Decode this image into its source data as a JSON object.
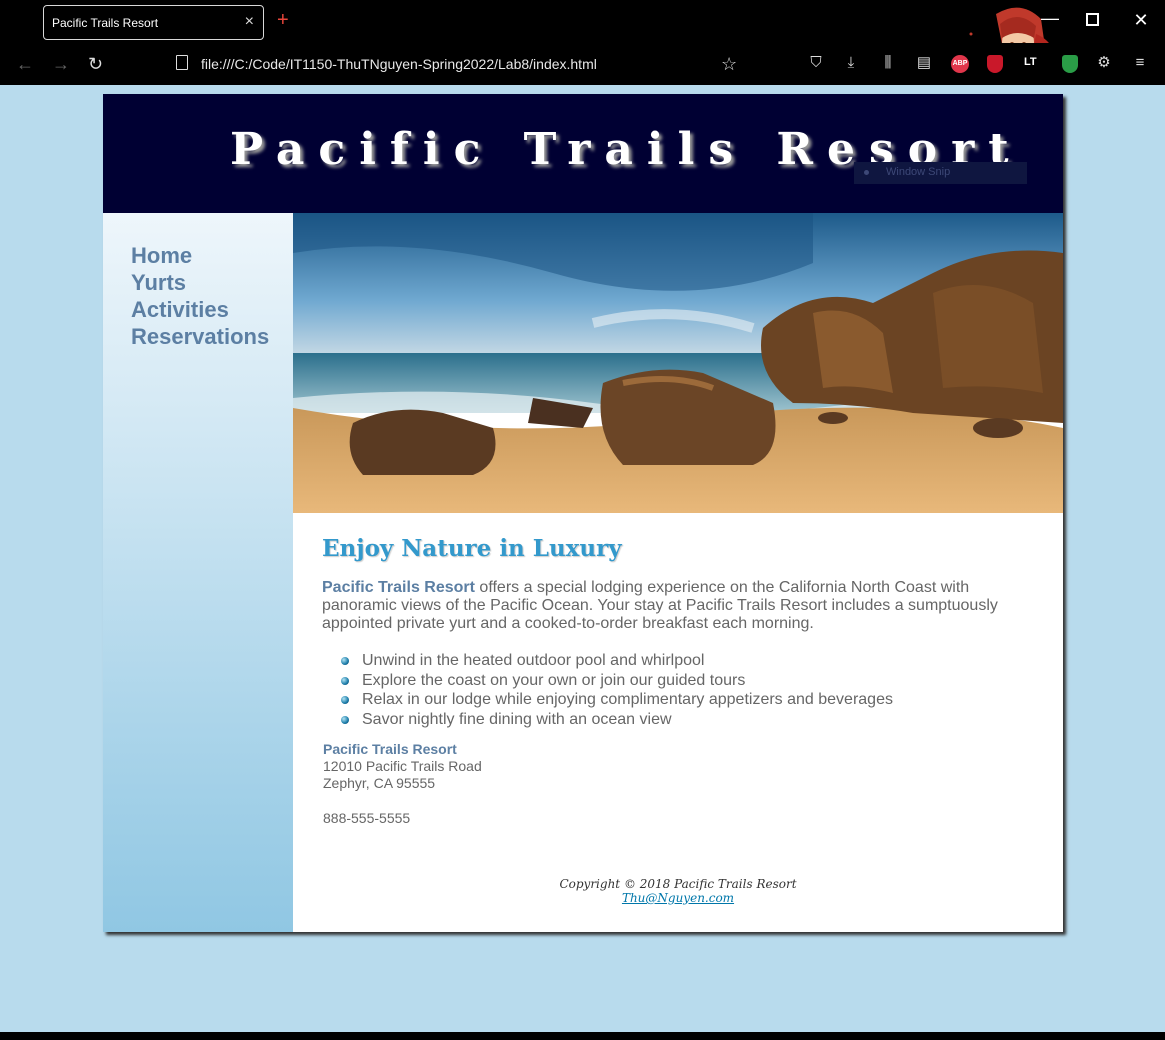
{
  "browser": {
    "tab_title": "Pacific Trails Resort",
    "tab_close": "×",
    "new_tab": "+",
    "url": "file:///C:/Code/IT1150-ThuTNguyen-Spring2022/Lab8/index.html",
    "extensions": {
      "abp_label": "ABP",
      "lt_label": "LT"
    }
  },
  "page": {
    "site_title": "Pacific Trails Resort",
    "snip_overlay": "Window Snip",
    "nav": [
      "Home",
      "Yurts",
      "Activities",
      "Reservations"
    ],
    "heading": "Enjoy Nature in Luxury",
    "intro_strong": "Pacific Trails Resort",
    "intro_text": " offers a special lodging experience on the California North Coast with panoramic views of the Pacific Ocean. Your stay at Pacific Trails Resort includes a sumptuously appointed private yurt and a cooked-to-order breakfast each morning.",
    "features": [
      "Unwind in the heated outdoor pool and whirlpool",
      "Explore the coast on your own or join our guided tours",
      "Relax in our lodge while enjoying complimentary appetizers and beverages",
      "Savor nightly fine dining with an ocean view"
    ],
    "contact": {
      "name": "Pacific Trails Resort",
      "street": "12010 Pacific Trails Road",
      "city": "Zephyr, CA 95555",
      "phone": "888-555-5555"
    },
    "footer": {
      "copyright": "Copyright © 2018 Pacific Trails Resort",
      "email": "Thu@Nguyen.com"
    }
  },
  "colors": {
    "header_bg": "#000033",
    "page_bg": "#b8dbed",
    "nav_text": "#5c7fa3",
    "heading": "#3399cc"
  }
}
